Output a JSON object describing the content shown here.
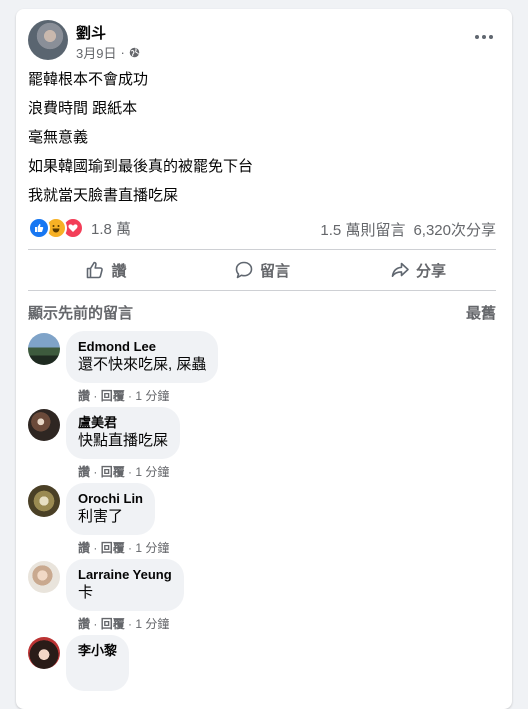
{
  "post": {
    "author": "劉斗",
    "date": "3月9日",
    "meta_sep": "·",
    "lines": [
      "罷韓根本不會成功",
      "浪費時間 跟紙本",
      "毫無意義",
      "如果韓國瑜到最後真的被罷免下台",
      "我就當天臉書直播吃屎"
    ],
    "reaction_count": "1.8 萬",
    "comment_count": "1.5 萬則留言",
    "share_count": "6,320次分享",
    "icons": [
      "globe-icon",
      "more-icon",
      "like-reaction-icon",
      "haha-reaction-icon",
      "love-reaction-icon"
    ]
  },
  "actions": {
    "like": "讚",
    "comment": "留言",
    "share": "分享"
  },
  "comments_section": {
    "show_previous": "顯示先前的留言",
    "sort": "最舊"
  },
  "comments": [
    {
      "name": "Edmond Lee",
      "text": "還不快來吃屎, 屎蟲",
      "like": "讚",
      "reply": "回覆",
      "time": "1 分鐘"
    },
    {
      "name": "盧美君",
      "text": "快點直播吃屎",
      "like": "讚",
      "reply": "回覆",
      "time": "1 分鐘"
    },
    {
      "name": "Orochi Lin",
      "text": "利害了",
      "like": "讚",
      "reply": "回覆",
      "time": "1 分鐘"
    },
    {
      "name": "Larraine Yeung",
      "text": "卡",
      "like": "讚",
      "reply": "回覆",
      "time": "1 分鐘"
    },
    {
      "name": "李小黎",
      "text": "",
      "like": "",
      "reply": "",
      "time": ""
    }
  ],
  "colors": {
    "background": "#f0f2f5",
    "card": "#ffffff",
    "secondary_text": "#65676b",
    "like_blue": "#1877f2",
    "haha_yellow": "#f7b125",
    "love_red": "#f33e58"
  }
}
